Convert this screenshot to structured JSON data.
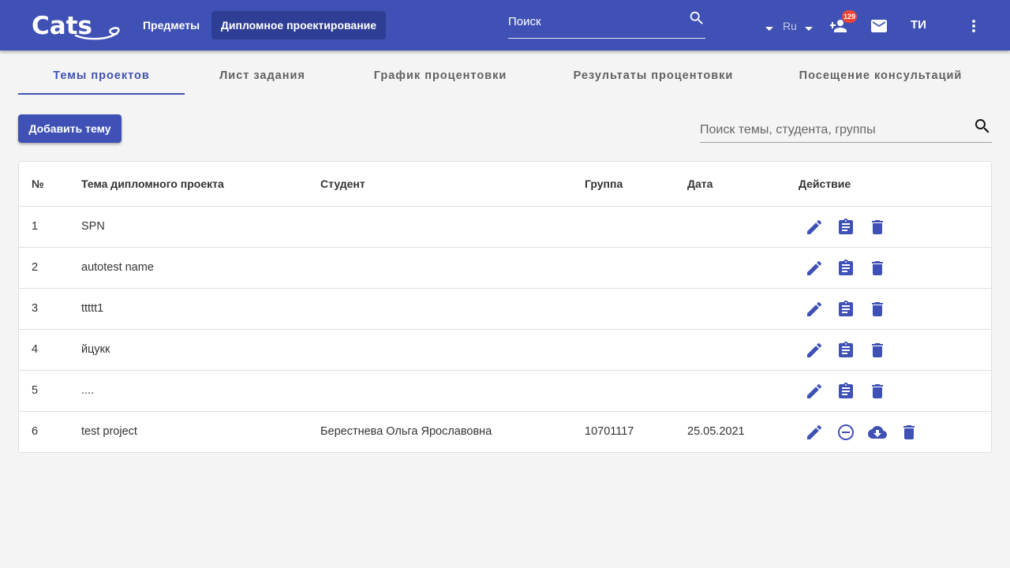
{
  "app": {
    "logo_text": "Cats",
    "nav": {
      "subjects_label": "Предметы",
      "diploma_label": "Дипломное проектирование"
    },
    "search": {
      "placeholder": "Поиск"
    },
    "language": "Ru",
    "notification_count": "129",
    "user_initials": "ТИ"
  },
  "tabs": [
    {
      "label": "Темы проектов",
      "active": true
    },
    {
      "label": "Лист задания",
      "active": false
    },
    {
      "label": "График процентовки",
      "active": false
    },
    {
      "label": "Результаты процентовки",
      "active": false
    },
    {
      "label": "Посещение консультаций",
      "active": false
    }
  ],
  "toolbar": {
    "add_topic_label": "Добавить тему",
    "filter_placeholder": "Поиск темы, студента, группы"
  },
  "table": {
    "headers": {
      "num": "№",
      "topic": "Тема дипломного проекта",
      "student": "Студент",
      "group": "Группа",
      "date": "Дата",
      "action": "Действие"
    },
    "rows": [
      {
        "num": "1",
        "topic": "SPN",
        "student": "",
        "group": "",
        "date": "",
        "actions": [
          "edit-icon",
          "assign-icon",
          "delete-icon"
        ]
      },
      {
        "num": "2",
        "topic": "autotest name",
        "student": "",
        "group": "",
        "date": "",
        "actions": [
          "edit-icon",
          "assign-icon",
          "delete-icon"
        ]
      },
      {
        "num": "3",
        "topic": "ttttt1",
        "student": "",
        "group": "",
        "date": "",
        "actions": [
          "edit-icon",
          "assign-icon",
          "delete-icon"
        ]
      },
      {
        "num": "4",
        "topic": "йцукк",
        "student": "",
        "group": "",
        "date": "",
        "actions": [
          "edit-icon",
          "assign-icon",
          "delete-icon"
        ]
      },
      {
        "num": "5",
        "topic": "....",
        "student": "",
        "group": "",
        "date": "",
        "actions": [
          "edit-icon",
          "assign-icon",
          "delete-icon"
        ]
      },
      {
        "num": "6",
        "topic": "test project",
        "student": "Берестнева Ольга Ярославовна",
        "group": "10701117",
        "date": "25.05.2021",
        "actions": [
          "edit-icon",
          "remove-circle-icon",
          "cloud-download-icon",
          "delete-icon"
        ]
      }
    ]
  },
  "colors": {
    "primary": "#3f51b5",
    "primary_dark": "#2f3e95",
    "badge": "#f44336",
    "background": "#f4f4f4"
  }
}
